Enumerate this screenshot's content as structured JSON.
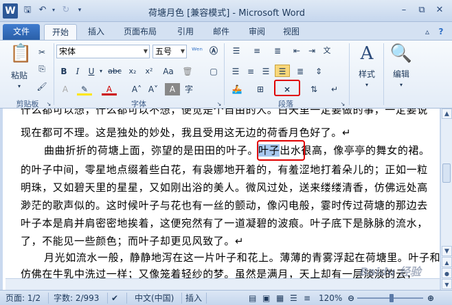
{
  "window": {
    "title": "荷塘月色 [兼容模式] - Microsoft Word",
    "app_icon": "W",
    "qat": {
      "save_icon": "save-icon",
      "undo_icon": "undo-icon",
      "redo_icon": "redo-icon"
    }
  },
  "tabs": [
    {
      "label": "文件",
      "active": false
    },
    {
      "label": "开始",
      "active": true
    },
    {
      "label": "插入",
      "active": false
    },
    {
      "label": "页面布局",
      "active": false
    },
    {
      "label": "引用",
      "active": false
    },
    {
      "label": "邮件",
      "active": false
    },
    {
      "label": "审阅",
      "active": false
    },
    {
      "label": "视图",
      "active": false
    }
  ],
  "ribbon": {
    "clipboard": {
      "paste_label": "粘贴",
      "group_label": "剪贴板"
    },
    "font": {
      "font_name": "宋体",
      "font_size": "五号",
      "group_label": "字体"
    },
    "paragraph": {
      "group_label": "段落"
    },
    "styles": {
      "label": "样式"
    },
    "editing": {
      "label": "编辑"
    }
  },
  "document": {
    "lines": [
      "什么都可以想，什么都可以不想，便觉是个自由的人。白天里一定要做的事，一定要说",
      "现在都可不理。这是独处的妙处，我且受用这无边的荷香月色好了。↵",
      "曲曲折折的荷塘上面，弥望的是田田的叶子。",
      "出水很高，像亭亭的舞女的裙。",
      "的叶子中间，零星地点缀着些白花，有袅娜地开着的，有羞涩地打着朵儿的；正如一粒",
      "明珠，又如碧天里的星星，又如刚出浴的美人。微风过处，送来缕缕清香，仿佛远处高",
      "渺茫的歌声似的。这时候叶子与花也有一丝的颤动，像闪电般，霎时传过荷塘的那边去",
      "叶子本是肩并肩密密地挨着，这便宛然有了一道凝碧的波痕。叶子底下是脉脉的流水，",
      "了，不能见一些颜色；而叶子却更见风致了。↵",
      "月光如流水一般，静静地泻在这一片叶子和花上。薄薄的青雾浮起在荷塘里。叶子和",
      "仿佛在牛乳中洗过一样；又像笼着轻纱的梦。虽然是满月，天上却有一层淡淡的云，"
    ],
    "selected_text": "叶子"
  },
  "statusbar": {
    "page": "页面: 1/2",
    "words": "字数: 2/993",
    "language": "中文(中国)",
    "mode": "插入",
    "zoom": "120%",
    "zoom_level_percent": 120
  },
  "watermark": "Baidu 经验"
}
